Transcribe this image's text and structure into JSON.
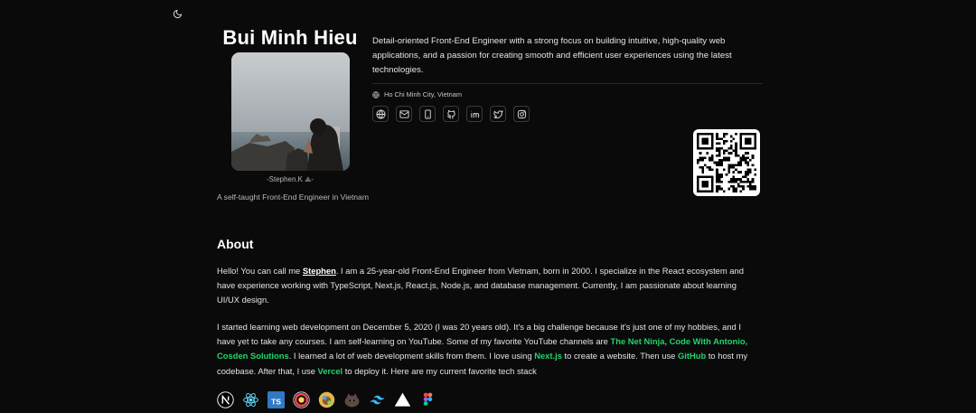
{
  "profile": {
    "name": "Bui Minh Hieu",
    "nickname": "-Stephen.K ⟁-",
    "tagline": "A self-taught Front-End Engineer in Vietnam"
  },
  "summary": "Detail-oriented Front-End Engineer with a strong focus on building intuitive, high-quality web applications, and a passion for creating smooth and efficient user experiences using the latest technologies.",
  "location": "Ho Chi Minh City, Vietnam",
  "socials": [
    {
      "icon": "globe-icon"
    },
    {
      "icon": "mail-icon"
    },
    {
      "icon": "phone-icon"
    },
    {
      "icon": "github-icon"
    },
    {
      "icon": "linkedin-icon"
    },
    {
      "icon": "twitter-icon"
    },
    {
      "icon": "instagram-icon"
    }
  ],
  "about": {
    "title": "About",
    "p1": {
      "before": "Hello! You can call me ",
      "name": "Stephen",
      "after": ". I am a 25-year-old Front-End Engineer from Vietnam, born in 2000. I specialize in the React ecosystem and have experience working with TypeScript, Next.js, React.js, Node.js, and database management. Currently, I am passionate about learning UI/UX design."
    },
    "p2": {
      "t1": "I started learning web development on December 5, 2020 (I was 20 years old). It's a big challenge because it's just one of my hobbies, and I have yet to take any courses. I am self-learning on YouTube. Some of my favorite YouTube channels are ",
      "ch1": "The Net Ninja",
      "sep1": ", ",
      "ch2": "Code With Antonio",
      "sep2": ", ",
      "ch3": "Cosden Solutions",
      "t2": ". I learned a lot of web development skills from them. I love using ",
      "tool1": "Next.js",
      "t3": " to create a website. Then use ",
      "tool2": "GitHub",
      "t4": " to host my codebase. After that, I use ",
      "tool3": "Vercel",
      "t5": " to deploy it. Here are my current favorite tech stack"
    }
  },
  "tech_stack": [
    "nextjs-icon",
    "react-icon",
    "typescript-icon",
    "tanstack-query-icon",
    "zustand-icon",
    "bun-icon",
    "tailwind-icon",
    "vercel-icon",
    "figma-icon"
  ],
  "colors": {
    "background": "#0a0a0b",
    "accent": "#22d46b",
    "text": "#e4e4e8"
  }
}
